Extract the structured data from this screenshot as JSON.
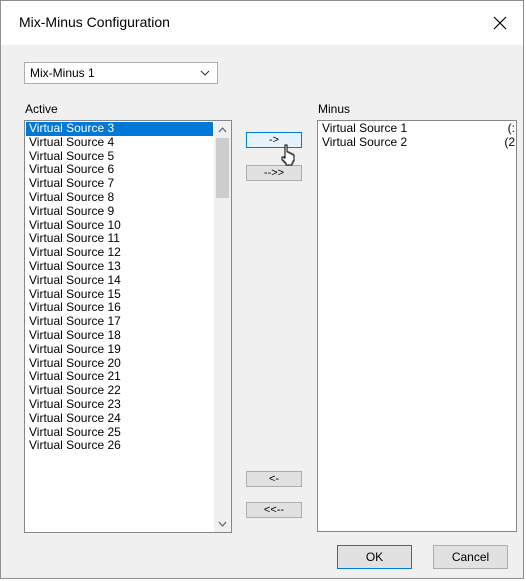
{
  "window": {
    "title": "Mix-Minus Configuration"
  },
  "mixminus_select": {
    "value": "Mix-Minus 1"
  },
  "active": {
    "label": "Active",
    "items": [
      "Virtual Source 3",
      "Virtual Source 4",
      "Virtual Source 5",
      "Virtual Source 6",
      "Virtual Source 7",
      "Virtual Source 8",
      "Virtual Source 9",
      "Virtual Source 10",
      "Virtual Source 11",
      "Virtual Source 12",
      "Virtual Source 13",
      "Virtual Source 14",
      "Virtual Source 15",
      "Virtual Source 16",
      "Virtual Source 17",
      "Virtual Source 18",
      "Virtual Source 19",
      "Virtual Source 20",
      "Virtual Source 21",
      "Virtual Source 22",
      "Virtual Source 23",
      "Virtual Source 24",
      "Virtual Source 25",
      "Virtual Source 26"
    ],
    "selected_index": 0
  },
  "minus": {
    "label": "Minus",
    "items": [
      {
        "name": "Virtual Source 1",
        "extra": "(:"
      },
      {
        "name": "Virtual Source 2",
        "extra": "(2"
      }
    ]
  },
  "transfer": {
    "add_label": "->",
    "add_all_label": "-->>",
    "remove_label": "<-",
    "remove_all_label": "<<--"
  },
  "buttons": {
    "ok_label": "OK",
    "cancel_label": "Cancel"
  }
}
